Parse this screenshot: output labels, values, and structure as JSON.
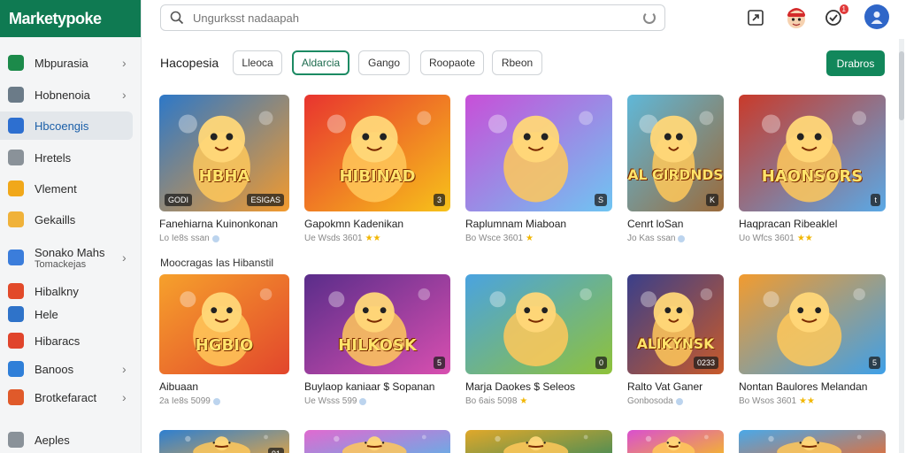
{
  "brand": "Marketypoke",
  "search": {
    "placeholder": "Ungurksst nadaapah"
  },
  "top_icons": {
    "notification_count": "1"
  },
  "sidebar": {
    "items": [
      {
        "label": "Mbpurasia",
        "icon": "home-icon",
        "color": "#1c8a4a",
        "chevron": "›"
      },
      {
        "label": "Hobnenoia",
        "icon": "store-icon",
        "color": "#6b7b88",
        "chevron": "›"
      },
      {
        "label": "Hbcoengis",
        "icon": "games-icon",
        "color": "#2d6fd0",
        "chevron": ""
      },
      {
        "label": "Hretels",
        "icon": "document-icon",
        "color": "#8a9299",
        "chevron": ""
      },
      {
        "label": "Vlement",
        "icon": "controller-icon",
        "color": "#f1a81a",
        "chevron": ""
      },
      {
        "label": "Gekaills",
        "icon": "burger-icon",
        "color": "#f0b23a",
        "chevron": ""
      },
      {
        "label": "Sonako Mahs",
        "sub": "Tomackejas",
        "icon": "pinwheel-icon",
        "color": "#3b7ddb",
        "chevron": "›"
      },
      {
        "label": "Hibalkny",
        "icon": "puzzle-icon",
        "color": "#e24a2a",
        "chevron": ""
      },
      {
        "label": "Hele",
        "icon": "tools-icon",
        "color": "#2f73c9",
        "chevron": ""
      },
      {
        "label": "Hibaracs",
        "icon": "board-icon",
        "color": "#e0452c",
        "chevron": ""
      },
      {
        "label": "Banoos",
        "icon": "user-icon",
        "color": "#2f7fd8",
        "chevron": "›"
      },
      {
        "label": "Brotkefaract",
        "icon": "gift-icon",
        "color": "#e05a2a",
        "chevron": "›"
      },
      {
        "label": "Aeples",
        "icon": "apps-icon",
        "color": "#8a9299",
        "chevron": ""
      }
    ]
  },
  "filters": {
    "breadcrumb": "Hacopesia",
    "chips": [
      "Lleoca",
      "Aldarcia",
      "Gango",
      "Roopaote",
      "Rbeon"
    ],
    "active_chip": 1,
    "action_label": "Drabros"
  },
  "section_label": "Moocragas Ias Hibanstil",
  "cards_row1": [
    {
      "title": "Fanehiarna Kuinonkonan",
      "meta": "Lo Ie8s ssan",
      "rating": "dot",
      "thumb_text": "HBHA",
      "tag": "ESIGAS",
      "ltag": "GODI",
      "bg1": "#2d78c8",
      "bg2": "#f39a2d"
    },
    {
      "title": "Gapokmn Kadenikan",
      "meta": "Ue Wsds 3601",
      "rating": "stars",
      "thumb_text": "HIBINAD",
      "tag": "3",
      "ltag": "",
      "bg1": "#e8342f",
      "bg2": "#f7c21a"
    },
    {
      "title": "Raplumnam Miaboan",
      "meta": "Bo Wsce 3601",
      "rating": "star",
      "thumb_text": "",
      "tag": "S",
      "ltag": "",
      "bg1": "#c84fd8",
      "bg2": "#6fc5f2"
    },
    {
      "title": "Cenrt loSan",
      "meta": "Jo Kas ssan",
      "rating": "dot",
      "thumb_text": "AL GIRDNDS",
      "tag": "K",
      "ltag": "",
      "bg1": "#5fb8d9",
      "bg2": "#9b6a3a"
    },
    {
      "title": "Haqpracan Ribeaklel",
      "meta": "Uo Wfcs 3601",
      "rating": "stars",
      "thumb_text": "HAONSORS",
      "tag": "t",
      "ltag": "",
      "bg1": "#c93a2a",
      "bg2": "#5aa9e6"
    }
  ],
  "cards_row2": [
    {
      "title": "Aibuaan",
      "meta": "2a Ie8s 5099",
      "rating": "dot",
      "thumb_text": "HGBIO",
      "tag": "",
      "ltag": "",
      "bg1": "#f6a12c",
      "bg2": "#e2462c"
    },
    {
      "title": "Buylaop kaniaar $ Sopanan",
      "meta": "Ue Wsss 599",
      "rating": "dot",
      "thumb_text": "HILKOSK",
      "tag": "5",
      "ltag": "",
      "bg1": "#5a2d8a",
      "bg2": "#d84fb0"
    },
    {
      "title": "Marja Daokes $ Seleos",
      "meta": "Bo 6ais 5098",
      "rating": "star",
      "thumb_text": "",
      "tag": "0",
      "ltag": "",
      "bg1": "#4aa3e0",
      "bg2": "#8fc23a"
    },
    {
      "title": "Ralto Vat Ganer",
      "meta": "Gonbosoda",
      "rating": "dot",
      "thumb_text": "ALIKYNSK",
      "tag": "0233",
      "ltag": "",
      "bg1": "#3a3f8a",
      "bg2": "#c85a2a"
    },
    {
      "title": "Nontan Baulores Melandan",
      "meta": "Bo Wsos 3601",
      "rating": "stars",
      "thumb_text": "",
      "tag": "5",
      "ltag": "",
      "bg1": "#f29b2f",
      "bg2": "#3fa0e8"
    }
  ],
  "cards_row3_partial": [
    {
      "tag": "91",
      "bg1": "#2e7fd0",
      "bg2": "#f0a83a"
    },
    {
      "tag": "",
      "bg1": "#e06ad0",
      "bg2": "#59b5e8"
    },
    {
      "tag": "",
      "bg1": "#e0a82a",
      "bg2": "#3a8a5a"
    },
    {
      "tag": "",
      "bg1": "#d94fd0",
      "bg2": "#f7c21a"
    },
    {
      "tag": "",
      "bg1": "#4aa8e8",
      "bg2": "#f06a2a"
    }
  ]
}
